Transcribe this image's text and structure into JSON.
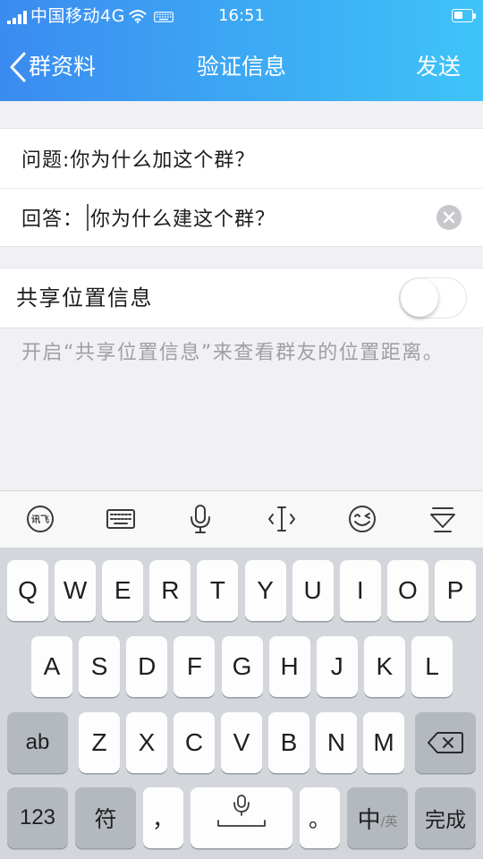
{
  "status_bar": {
    "carrier": "中国移动4G",
    "time": "16:51",
    "battery_level": 0.5,
    "icons": {
      "signal": "signal-icon",
      "wifi": "wifi-icon",
      "keyboard": "keyboard-status-icon",
      "battery": "battery-icon"
    }
  },
  "nav": {
    "back_icon": "chevron-left-icon",
    "back_label": "群资料",
    "title": "验证信息",
    "action_label": "发送"
  },
  "form": {
    "question_label": "问题:",
    "question_text": "你为什么加这个群？",
    "answer_label": "回答：",
    "answer_value": "你为什么建这个群？",
    "clear_icon": "clear-circle-icon"
  },
  "share_location": {
    "label": "共享位置信息",
    "enabled": false,
    "hint": "开启“共享位置信息”来查看群友的位置距离。"
  },
  "keyboard": {
    "logo_text": "讯飞",
    "toolbar_icons": [
      "xunfei-logo-icon",
      "keyboard-switch-icon",
      "microphone-icon",
      "cursor-move-icon",
      "emoji-icon",
      "hide-keyboard-icon"
    ],
    "row1": [
      "Q",
      "W",
      "E",
      "R",
      "T",
      "Y",
      "U",
      "I",
      "O",
      "P"
    ],
    "row2": [
      "A",
      "S",
      "D",
      "F",
      "G",
      "H",
      "J",
      "K",
      "L"
    ],
    "row3": [
      "Z",
      "X",
      "C",
      "V",
      "B",
      "N",
      "M"
    ],
    "case_label": "ab",
    "backspace_icon": "backspace-icon",
    "numbers_label": "123",
    "symbols_label": "符",
    "comma": "，",
    "space_icon": "microphone-space-icon",
    "period": "。",
    "lang_primary": "中",
    "lang_secondary": "/英",
    "done_label": "完成"
  },
  "colors": {
    "header_start": "#3b8bf0",
    "header_end": "#3ec4f8",
    "page_background": "#f0f0f5",
    "hint_text": "#a0a0a0",
    "keyboard_background": "#d3d6db",
    "function_key": "#b4b8bf",
    "clear_button": "#c7c7cc"
  }
}
